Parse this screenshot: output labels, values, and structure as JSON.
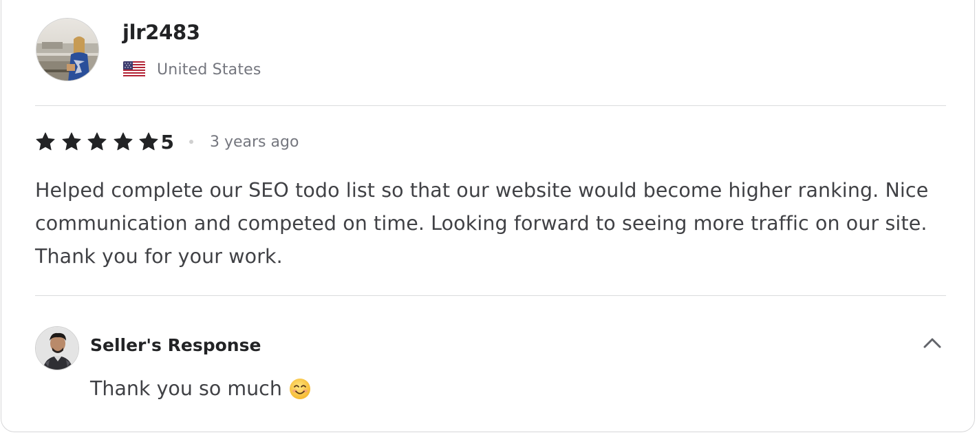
{
  "reviewer": {
    "username": "jlr2483",
    "country": "United States"
  },
  "rating": {
    "stars": 5,
    "score": "5",
    "time_ago": "3 years ago"
  },
  "review": {
    "text": "Helped complete our SEO todo list so that our website would become higher ranking. Nice communication and competed on time. Looking forward to seeing more traffic on our site. Thank you for your work."
  },
  "seller_response": {
    "title": "Seller's Response",
    "text": "Thank you so much"
  },
  "icons": {
    "star": "star-icon",
    "flag": "us-flag-icon",
    "collapse": "chevron-up-icon",
    "emoji": "smiling-face-emoji"
  },
  "colors": {
    "star": "#222325",
    "text": "#404145",
    "muted": "#74767e",
    "divider": "#dadbdd"
  }
}
